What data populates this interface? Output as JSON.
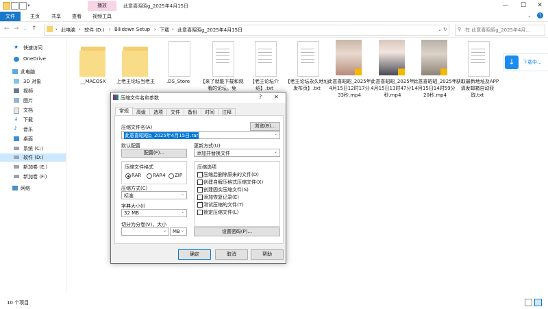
{
  "window": {
    "title": "此意喜昭昭g_2025年4月15日",
    "context_tab": "播放"
  },
  "ribbon": {
    "tabs": [
      "文件",
      "主页",
      "共享",
      "查看",
      "视频工具"
    ]
  },
  "address": {
    "segments": [
      "此电脑",
      "软件 (D:)",
      "Bilidown Setup",
      "下载",
      "此意喜昭昭g_2025年4月15日"
    ],
    "search_placeholder": "在 此意喜昭昭g_2025年4月..."
  },
  "sidebar": {
    "items": [
      {
        "label": "快速访问",
        "icon": "star-icon"
      },
      {
        "label": "OneDrive",
        "icon": "cloud-icon"
      },
      {
        "label": "此电脑",
        "icon": "computer-icon"
      },
      {
        "label": "3D 对象",
        "icon": "cube-icon"
      },
      {
        "label": "视频",
        "icon": "video-icon"
      },
      {
        "label": "图片",
        "icon": "picture-icon"
      },
      {
        "label": "文档",
        "icon": "document-icon"
      },
      {
        "label": "下载",
        "icon": "download-icon"
      },
      {
        "label": "音乐",
        "icon": "music-icon"
      },
      {
        "label": "桌面",
        "icon": "desktop-icon"
      },
      {
        "label": "系统 (C:)",
        "icon": "drive-icon"
      },
      {
        "label": "软件 (D:)",
        "icon": "drive-icon"
      },
      {
        "label": "新加卷 (E:)",
        "icon": "drive-icon"
      },
      {
        "label": "新加卷 (F:)",
        "icon": "drive-icon"
      },
      {
        "label": "网络",
        "icon": "network-icon"
      }
    ]
  },
  "files": [
    {
      "name": "__MACOSX",
      "kind": "folder"
    },
    {
      "name": "上老王论坛当老王",
      "kind": "folder"
    },
    {
      "name": ".DS_Store",
      "kind": "file"
    },
    {
      "name": "【来了就能下载和观看的论坛。免费,,,】.txt",
      "kind": "txt"
    },
    {
      "name": "【老王论坛介绍】.txt",
      "kind": "txt"
    },
    {
      "name": "【老王论坛永久地址发布页】.txt",
      "kind": "txt"
    },
    {
      "name": "此意喜昭昭_2025年4月15日12时17分33秒.mp4",
      "kind": "video"
    },
    {
      "name": "此意喜昭昭_2025年4月15日13时47分1秒.mp4",
      "kind": "video"
    },
    {
      "name": "此意喜昭昭_2025年4月15日14时59分20秒.mp4",
      "kind": "video"
    },
    {
      "name": "获取最新地址及APP请发邮箱自动获取.txt",
      "kind": "txt"
    }
  ],
  "status": {
    "count": "10 个项目"
  },
  "download_panel": {
    "label": "下载中..."
  },
  "dialog": {
    "title": "压缩文件名和参数",
    "help_char": "?",
    "close_char": "✕",
    "tabs": [
      "常规",
      "高级",
      "选项",
      "文件",
      "备份",
      "时间",
      "注释"
    ],
    "archive_name_label": "压缩文件名(A)",
    "browse_button": "浏览(B)...",
    "archive_name_value": "此意喜昭昭g_2025年4月15日.rar",
    "default_profile_label": "默认配置",
    "profiles_button": "配置(F)...",
    "update_mode_label": "更新方式(U)",
    "update_mode_value": "添加并替换文件",
    "format_label": "压缩文件格式",
    "formats": [
      "RAR",
      "RAR4",
      "ZIP"
    ],
    "selected_format": "RAR",
    "method_label": "压缩方式(C)",
    "method_value": "标准",
    "dict_label": "字典大小(I)",
    "dict_value": "32 MB",
    "split_label": "切分为分卷(V)，大小",
    "split_unit": "MB",
    "options_label": "压缩选项",
    "options": [
      "压缩后删除原来的文件(D)",
      "创建自解压格式压缩文件(X)",
      "创建固实压缩文件(S)",
      "添加恢复记录(E)",
      "测试压缩的文件(T)",
      "锁定压缩文件(L)"
    ],
    "password_button": "设置密码(P)...",
    "ok_button": "确定",
    "cancel_button": "取消",
    "help_button": "帮助"
  }
}
